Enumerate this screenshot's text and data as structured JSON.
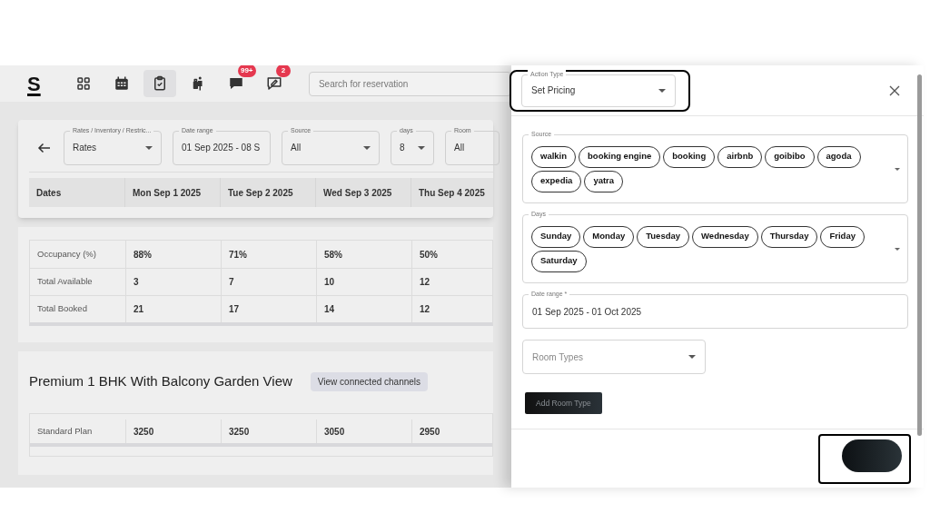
{
  "header": {
    "logo": "S",
    "nav": [
      {
        "kind": "grid",
        "selected": false
      },
      {
        "kind": "calendar",
        "selected": false
      },
      {
        "kind": "clipboard",
        "selected": true
      },
      {
        "kind": "luggage",
        "selected": false
      },
      {
        "kind": "chat",
        "selected": false,
        "badge": "99+"
      },
      {
        "kind": "chat-edit",
        "selected": false,
        "badge": "2"
      }
    ],
    "search": {
      "placeholder": "Search for reservation"
    }
  },
  "filters": [
    {
      "label": "Rates / Inventory / Restric...",
      "value": "Rates",
      "kind": "select"
    },
    {
      "label": "Date range",
      "value": "01 Sep 2025 - 08 S",
      "kind": "text"
    },
    {
      "label": "Source",
      "value": "All",
      "kind": "select"
    },
    {
      "label": "days",
      "value": "8",
      "kind": "select"
    },
    {
      "label": "Room",
      "value": "All",
      "kind": "text"
    }
  ],
  "dates_header": [
    "Dates",
    "Mon Sep 1 2025",
    "Tue Sep 2 2025",
    "Wed Sep 3 2025",
    "Thu Sep 4 2025"
  ],
  "summary": [
    {
      "label": "Occupancy (%)",
      "values": [
        "88%",
        "71%",
        "58%",
        "50%"
      ]
    },
    {
      "label": "Total Available",
      "values": [
        "3",
        "7",
        "10",
        "12"
      ]
    },
    {
      "label": "Total Booked",
      "values": [
        "21",
        "17",
        "14",
        "12"
      ]
    }
  ],
  "room": {
    "title": "Premium 1 BHK With Balcony Garden View",
    "button": "View connected channels",
    "rows": [
      {
        "label": "Standard Plan",
        "values": [
          "3250",
          "3250",
          "3050",
          "2950"
        ]
      }
    ]
  },
  "drawer": {
    "action_type": {
      "label": "Action Type",
      "value": "Set Pricing",
      "annotated": true
    },
    "source": {
      "label": "Source",
      "chips": [
        "walkin",
        "booking engine",
        "booking",
        "airbnb",
        "goibibo",
        "agoda",
        "expedia",
        "yatra"
      ]
    },
    "days": {
      "label": "Days",
      "chips": [
        "Sunday",
        "Monday",
        "Tuesday",
        "Wednesday",
        "Thursday",
        "Friday",
        "Saturday"
      ]
    },
    "date_range": {
      "label": "Date range *",
      "value": "01 Sep 2025 - 01 Oct 2025"
    },
    "room_types": {
      "placeholder": "Room Types"
    },
    "add_button": "Add Room Type",
    "submit": {
      "annotated": true
    }
  }
}
